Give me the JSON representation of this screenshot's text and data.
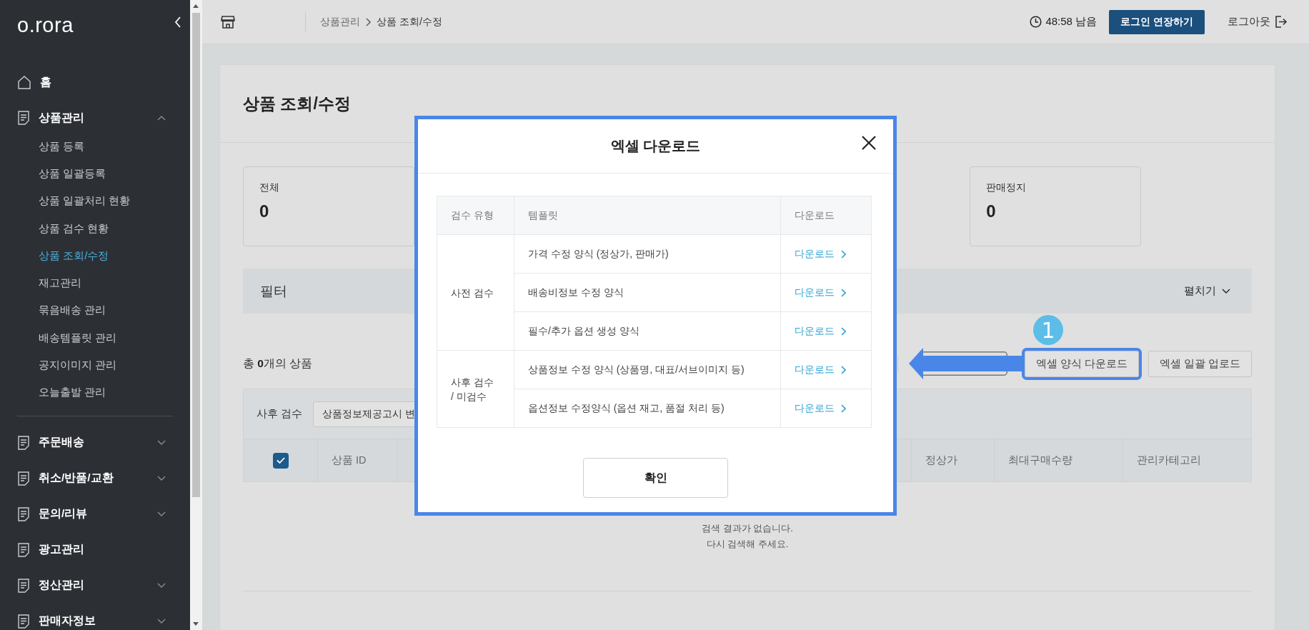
{
  "sidebar": {
    "logo": "o.rora",
    "items": [
      {
        "label": "홈",
        "kind": "home"
      },
      {
        "label": "상품관리",
        "kind": "group",
        "expanded": true,
        "children": [
          {
            "label": "상품 등록",
            "selected": false
          },
          {
            "label": "상품 일괄등록",
            "selected": false
          },
          {
            "label": "상품 일괄처리 현황",
            "selected": false
          },
          {
            "label": "상품 검수 현황",
            "selected": false
          },
          {
            "label": "상품 조회/수정",
            "selected": true
          },
          {
            "label": "재고관리",
            "selected": false
          },
          {
            "label": "묶음배송 관리",
            "selected": false
          },
          {
            "label": "배송템플릿 관리",
            "selected": false
          },
          {
            "label": "공지이미지 관리",
            "selected": false
          },
          {
            "label": "오늘출발 관리",
            "selected": false
          }
        ]
      },
      {
        "label": "주문배송",
        "kind": "group",
        "expanded": false
      },
      {
        "label": "취소/반품/교환",
        "kind": "group",
        "expanded": false
      },
      {
        "label": "문의/리뷰",
        "kind": "group",
        "expanded": false
      },
      {
        "label": "광고관리",
        "kind": "page"
      },
      {
        "label": "정산관리",
        "kind": "group",
        "expanded": false
      },
      {
        "label": "판매자정보",
        "kind": "group",
        "expanded": false
      }
    ]
  },
  "topbar": {
    "breadcrumb": [
      "상품관리",
      "상품 조회/수정"
    ],
    "time_left": "48:58 남음",
    "extend_button": "로그인 연장하기",
    "logout": "로그아웃"
  },
  "page": {
    "title": "상품 조회/수정",
    "stat_cards": [
      {
        "label": "전체",
        "value": "0"
      },
      {
        "label": "판매정지",
        "value": "0"
      }
    ],
    "filter": {
      "label": "필터",
      "toggle": "펼치기"
    },
    "total": "총 **0**개의 상품",
    "buttons": [
      {
        "label": "엑셀 양식 다운로드",
        "highlighted": true
      },
      {
        "label": "엑셀 일괄 업로드",
        "highlighted": false
      }
    ],
    "annotation_badge": "1",
    "table": {
      "filter_label": "사후 검수",
      "filter_select": "상품정보제공고시 변",
      "select_all_checked": true,
      "columns": [
        "상품 ID",
        "정상가",
        "최대구매수량",
        "관리카테고리"
      ]
    },
    "empty_message": [
      "검색 결과가 없습니다.",
      "다시 검색해 주세요."
    ]
  },
  "modal": {
    "title": "엑셀 다운로드",
    "columns": [
      "검수 유형",
      "템플릿",
      "다운로드"
    ],
    "groups": [
      {
        "type": "사전 검수",
        "rows": [
          {
            "template": "가격 수정 양식 (정상가, 판매가)",
            "link": "다운로드"
          },
          {
            "template": "배송비정보 수정 양식",
            "link": "다운로드"
          },
          {
            "template": "필수/추가 옵션 생성 양식",
            "link": "다운로드"
          }
        ]
      },
      {
        "type": "사후 검수\n/ 미검수",
        "rows": [
          {
            "template": "상품정보 수정 양식 (상품명, 대표/서브이미지 등)",
            "link": "다운로드"
          },
          {
            "template": "옵션정보 수정양식 (옵션 재고, 품절 처리 등)",
            "link": "다운로드"
          }
        ]
      }
    ],
    "confirm": "확인"
  }
}
